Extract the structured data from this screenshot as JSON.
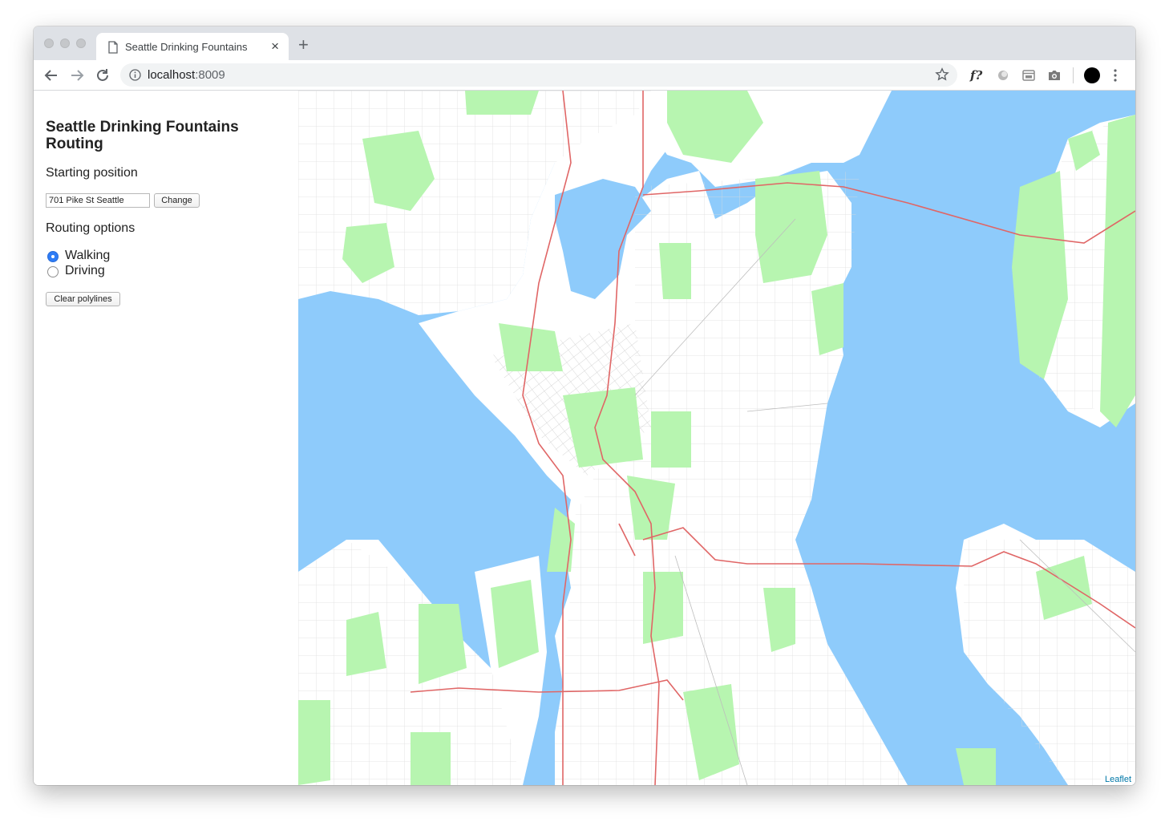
{
  "browser": {
    "tab_title": "Seattle Drinking Fountains",
    "tab_close": "×",
    "new_tab": "+",
    "url_host": "localhost",
    "url_port": ":8009"
  },
  "sidebar": {
    "title": "Seattle Drinking Fountains Routing",
    "starting_position_label": "Starting position",
    "address_value": "701 Pike St Seattle",
    "change_button": "Change",
    "routing_options_label": "Routing options",
    "options": [
      {
        "label": "Walking",
        "selected": true
      },
      {
        "label": "Driving",
        "selected": false
      }
    ],
    "clear_button": "Clear polylines"
  },
  "map": {
    "attribution": "Leaflet",
    "colors": {
      "water": "#8ecbfb",
      "land": "#ffffff",
      "park": "#b7f5b0",
      "highway": "#e06666",
      "street": "#cfcfcf"
    }
  }
}
